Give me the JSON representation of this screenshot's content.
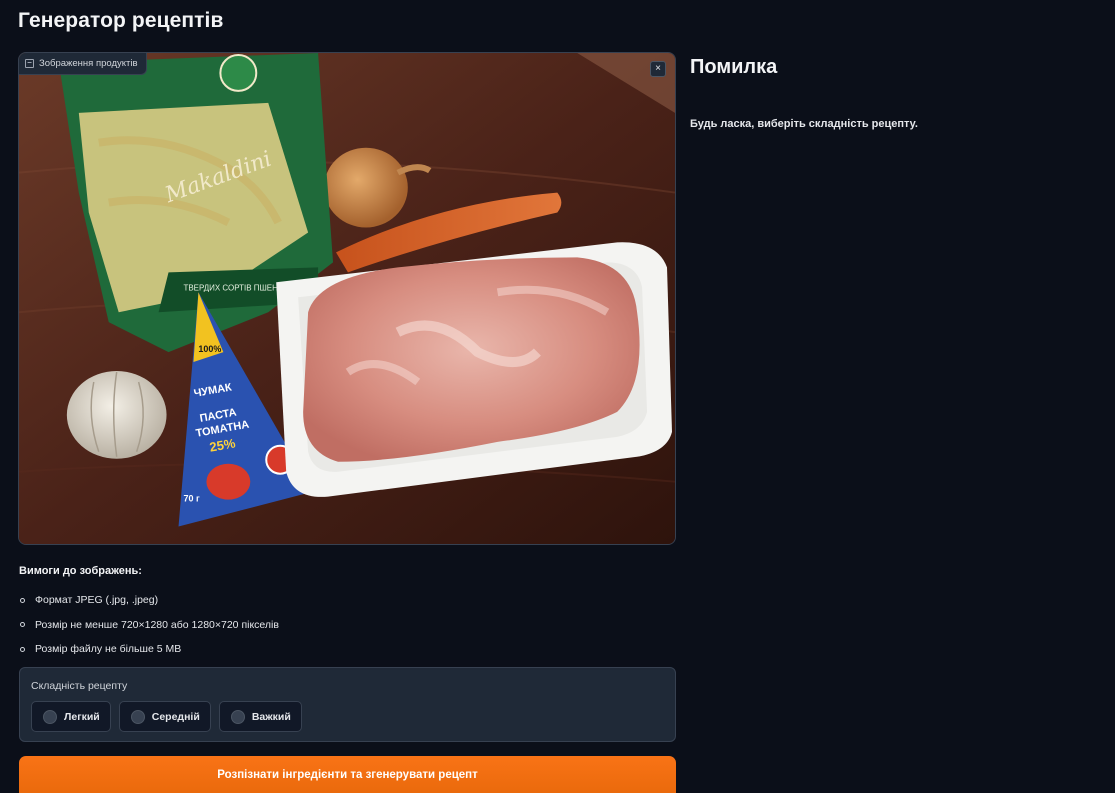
{
  "app": {
    "title": "Генератор рецептів"
  },
  "image_input": {
    "label": "Зображення продуктів",
    "close_symbol": "×",
    "icon": "image-icon",
    "pack_labels": {
      "pasta_brand": "Makaldini",
      "pasta_text": "ТВЕРДИХ СОРТІВ ПШЕНИЦІ",
      "paste_badge": "100%",
      "paste_brand": "ЧУМАК",
      "paste_line1": "ПАСТА",
      "paste_line2": "ТОМАТНА",
      "paste_percent": "25%",
      "paste_weight": "70 г"
    }
  },
  "error": {
    "title": "Помилка",
    "message": "Будь ласка, виберіть складність рецепту."
  },
  "requirements": {
    "title": "Вимоги до зображень:",
    "items": [
      "Формат JPEG (.jpg, .jpeg)",
      "Розмір не менше 720×1280 або 1280×720 пікселів",
      "Розмір файлу не більше 5 MB"
    ]
  },
  "difficulty": {
    "label": "Складність рецепту",
    "options": [
      "Легкий",
      "Середній",
      "Важкий"
    ]
  },
  "submit": {
    "label": "Розпізнати інгредієнти та згенерувати рецепт"
  },
  "colors": {
    "background": "#0b0f19",
    "panel": "#1f2937",
    "accent": "#f97316"
  }
}
